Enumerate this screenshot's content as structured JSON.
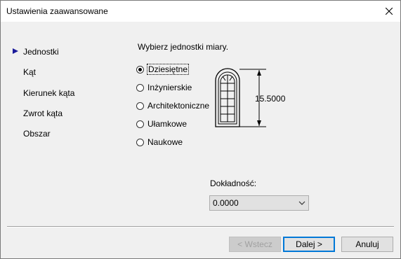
{
  "window": {
    "title": "Ustawienia zaawansowane"
  },
  "nav": {
    "items": [
      {
        "label": "Jednostki",
        "active": true
      },
      {
        "label": "Kąt"
      },
      {
        "label": "Kierunek kąta"
      },
      {
        "label": "Zwrot kąta"
      },
      {
        "label": "Obszar"
      }
    ]
  },
  "units": {
    "prompt": "Wybierz jednostki miary.",
    "options": [
      {
        "label": "Dziesiętne",
        "selected": true
      },
      {
        "label": "Inżynierskie"
      },
      {
        "label": "Architektoniczne"
      },
      {
        "label": "Ułamkowe"
      },
      {
        "label": "Naukowe"
      }
    ],
    "preview_value": "15.5000"
  },
  "precision": {
    "label": "Dokładność:",
    "value": "0.0000"
  },
  "buttons": {
    "back": "< Wstecz",
    "next": "Dalej >",
    "cancel": "Anuluj"
  },
  "icons": {
    "close": "close-icon",
    "dropdown": "chevron-down-icon",
    "nav_marker": "triangle-right-icon",
    "preview": "window-drawing-icon"
  },
  "colors": {
    "nav_marker": "#1a1a9a",
    "default_button_border": "#0078d7"
  }
}
